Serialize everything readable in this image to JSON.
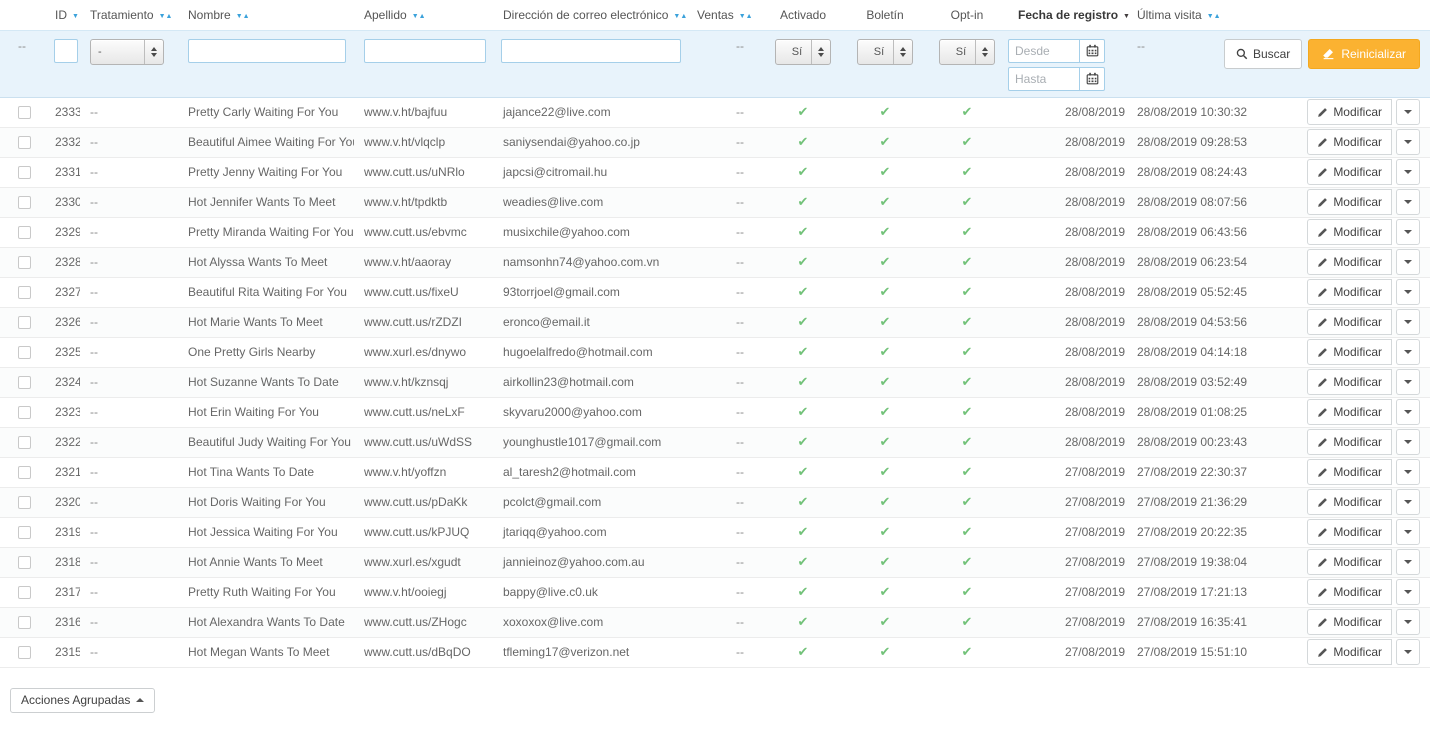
{
  "colors": {
    "accent_blue": "#3BA2DB",
    "success_green": "#72C279",
    "warning_orange": "#FBB231",
    "filter_bg": "#E8F3FB"
  },
  "glyphs": {
    "sort_desc": "▼",
    "sort_asc": "▲",
    "check": "✔"
  },
  "sort": {
    "column": "fecha_registro",
    "direction": "desc"
  },
  "columns": {
    "id": "ID",
    "tratamiento": "Tratamiento",
    "nombre": "Nombre",
    "apellido": "Apellido",
    "email": "Dirección de correo electrónico",
    "ventas": "Ventas",
    "activado": "Activado",
    "boletin": "Boletín",
    "optin": "Opt-in",
    "fecha_registro": "Fecha de registro",
    "ultima_visita": "Última visita"
  },
  "filters": {
    "empty": "--",
    "id_value": "",
    "tratamiento_value": "-",
    "nombre_value": "",
    "apellido_value": "",
    "email_value": "",
    "activado_value": "Sí",
    "boletin_value": "Sí",
    "optin_value": "Sí",
    "desde_placeholder": "Desde",
    "hasta_placeholder": "Hasta",
    "search_label": "Buscar",
    "reset_label": "Reinicializar"
  },
  "row_actions": {
    "modify_label": "Modificar"
  },
  "footer": {
    "bulk_actions_label": "Acciones Agrupadas"
  },
  "rows": [
    {
      "id": "2333",
      "tratamiento": "--",
      "nombre": "Pretty Carly Waiting For You",
      "apellido": "www.v.ht/bajfuu",
      "email": "jajance22@live.com",
      "ventas": "--",
      "activado": true,
      "boletin": true,
      "optin": true,
      "fecha_registro": "28/08/2019",
      "ultima_visita": "28/08/2019 10:30:32"
    },
    {
      "id": "2332",
      "tratamiento": "--",
      "nombre": "Beautiful Aimee Waiting For You",
      "apellido": "www.v.ht/vlqclp",
      "email": "saniysendai@yahoo.co.jp",
      "ventas": "--",
      "activado": true,
      "boletin": true,
      "optin": true,
      "fecha_registro": "28/08/2019",
      "ultima_visita": "28/08/2019 09:28:53"
    },
    {
      "id": "2331",
      "tratamiento": "--",
      "nombre": "Pretty Jenny Waiting For You",
      "apellido": "www.cutt.us/uNRlo",
      "email": "japcsi@citromail.hu",
      "ventas": "--",
      "activado": true,
      "boletin": true,
      "optin": true,
      "fecha_registro": "28/08/2019",
      "ultima_visita": "28/08/2019 08:24:43"
    },
    {
      "id": "2330",
      "tratamiento": "--",
      "nombre": "Hot Jennifer Wants To Meet",
      "apellido": "www.v.ht/tpdktb",
      "email": "weadies@live.com",
      "ventas": "--",
      "activado": true,
      "boletin": true,
      "optin": true,
      "fecha_registro": "28/08/2019",
      "ultima_visita": "28/08/2019 08:07:56"
    },
    {
      "id": "2329",
      "tratamiento": "--",
      "nombre": "Pretty Miranda Waiting For You",
      "apellido": "www.cutt.us/ebvmc",
      "email": "musixchile@yahoo.com",
      "ventas": "--",
      "activado": true,
      "boletin": true,
      "optin": true,
      "fecha_registro": "28/08/2019",
      "ultima_visita": "28/08/2019 06:43:56"
    },
    {
      "id": "2328",
      "tratamiento": "--",
      "nombre": "Hot Alyssa Wants To Meet",
      "apellido": "www.v.ht/aaoray",
      "email": "namsonhn74@yahoo.com.vn",
      "ventas": "--",
      "activado": true,
      "boletin": true,
      "optin": true,
      "fecha_registro": "28/08/2019",
      "ultima_visita": "28/08/2019 06:23:54"
    },
    {
      "id": "2327",
      "tratamiento": "--",
      "nombre": "Beautiful Rita Waiting For You",
      "apellido": "www.cutt.us/fixeU",
      "email": "93torrjoel@gmail.com",
      "ventas": "--",
      "activado": true,
      "boletin": true,
      "optin": true,
      "fecha_registro": "28/08/2019",
      "ultima_visita": "28/08/2019 05:52:45"
    },
    {
      "id": "2326",
      "tratamiento": "--",
      "nombre": "Hot Marie Wants To Meet",
      "apellido": "www.cutt.us/rZDZI",
      "email": "eronco@email.it",
      "ventas": "--",
      "activado": true,
      "boletin": true,
      "optin": true,
      "fecha_registro": "28/08/2019",
      "ultima_visita": "28/08/2019 04:53:56"
    },
    {
      "id": "2325",
      "tratamiento": "--",
      "nombre": "One Pretty Girls Nearby",
      "apellido": "www.xurl.es/dnywo",
      "email": "hugoelalfredo@hotmail.com",
      "ventas": "--",
      "activado": true,
      "boletin": true,
      "optin": true,
      "fecha_registro": "28/08/2019",
      "ultima_visita": "28/08/2019 04:14:18"
    },
    {
      "id": "2324",
      "tratamiento": "--",
      "nombre": "Hot Suzanne Wants To Date",
      "apellido": "www.v.ht/kznsqj",
      "email": "airkollin23@hotmail.com",
      "ventas": "--",
      "activado": true,
      "boletin": true,
      "optin": true,
      "fecha_registro": "28/08/2019",
      "ultima_visita": "28/08/2019 03:52:49"
    },
    {
      "id": "2323",
      "tratamiento": "--",
      "nombre": "Hot Erin Waiting For You",
      "apellido": "www.cutt.us/neLxF",
      "email": "skyvaru2000@yahoo.com",
      "ventas": "--",
      "activado": true,
      "boletin": true,
      "optin": true,
      "fecha_registro": "28/08/2019",
      "ultima_visita": "28/08/2019 01:08:25"
    },
    {
      "id": "2322",
      "tratamiento": "--",
      "nombre": "Beautiful Judy Waiting For You",
      "apellido": "www.cutt.us/uWdSS",
      "email": "younghustle1017@gmail.com",
      "ventas": "--",
      "activado": true,
      "boletin": true,
      "optin": true,
      "fecha_registro": "28/08/2019",
      "ultima_visita": "28/08/2019 00:23:43"
    },
    {
      "id": "2321",
      "tratamiento": "--",
      "nombre": "Hot Tina Wants To Date",
      "apellido": "www.v.ht/yoffzn",
      "email": "al_taresh2@hotmail.com",
      "ventas": "--",
      "activado": true,
      "boletin": true,
      "optin": true,
      "fecha_registro": "27/08/2019",
      "ultima_visita": "27/08/2019 22:30:37"
    },
    {
      "id": "2320",
      "tratamiento": "--",
      "nombre": "Hot Doris Waiting For You",
      "apellido": "www.cutt.us/pDaKk",
      "email": "pcolct@gmail.com",
      "ventas": "--",
      "activado": true,
      "boletin": true,
      "optin": true,
      "fecha_registro": "27/08/2019",
      "ultima_visita": "27/08/2019 21:36:29"
    },
    {
      "id": "2319",
      "tratamiento": "--",
      "nombre": "Hot Jessica Waiting For You",
      "apellido": "www.cutt.us/kPJUQ",
      "email": "jtariqq@yahoo.com",
      "ventas": "--",
      "activado": true,
      "boletin": true,
      "optin": true,
      "fecha_registro": "27/08/2019",
      "ultima_visita": "27/08/2019 20:22:35"
    },
    {
      "id": "2318",
      "tratamiento": "--",
      "nombre": "Hot Annie Wants To Meet",
      "apellido": "www.xurl.es/xgudt",
      "email": "jannieinoz@yahoo.com.au",
      "ventas": "--",
      "activado": true,
      "boletin": true,
      "optin": true,
      "fecha_registro": "27/08/2019",
      "ultima_visita": "27/08/2019 19:38:04"
    },
    {
      "id": "2317",
      "tratamiento": "--",
      "nombre": "Pretty Ruth Waiting For You",
      "apellido": "www.v.ht/ooiegj",
      "email": "bappy@live.c0.uk",
      "ventas": "--",
      "activado": true,
      "boletin": true,
      "optin": true,
      "fecha_registro": "27/08/2019",
      "ultima_visita": "27/08/2019 17:21:13"
    },
    {
      "id": "2316",
      "tratamiento": "--",
      "nombre": "Hot Alexandra Wants To Date",
      "apellido": "www.cutt.us/ZHogc",
      "email": "xoxoxox@live.com",
      "ventas": "--",
      "activado": true,
      "boletin": true,
      "optin": true,
      "fecha_registro": "27/08/2019",
      "ultima_visita": "27/08/2019 16:35:41"
    },
    {
      "id": "2315",
      "tratamiento": "--",
      "nombre": "Hot Megan Wants To Meet",
      "apellido": "www.cutt.us/dBqDO",
      "email": "tfleming17@verizon.net",
      "ventas": "--",
      "activado": true,
      "boletin": true,
      "optin": true,
      "fecha_registro": "27/08/2019",
      "ultima_visita": "27/08/2019 15:51:10"
    }
  ]
}
